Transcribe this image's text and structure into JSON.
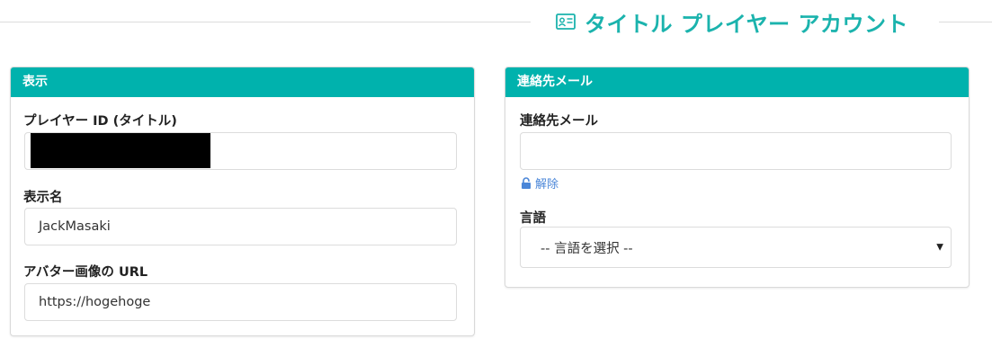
{
  "header": {
    "title": "タイトル プレイヤー アカウント",
    "icon": "id-card-icon",
    "accent_color": "#1bb3ad"
  },
  "display_panel": {
    "heading": "表示",
    "player_id_label": "プレイヤー ID (タイトル)",
    "player_id_value": "",
    "display_name_label": "表示名",
    "display_name_value": "JackMasaki",
    "avatar_url_label": "アバター画像の URL",
    "avatar_url_value": "https://hogehoge"
  },
  "contact_panel": {
    "heading": "連絡先メール",
    "email_label": "連絡先メール",
    "email_value": "",
    "unlock_label": "解除",
    "language_label": "言語",
    "language_selected": "-- 言語を選択 --"
  },
  "colors": {
    "panel_header": "#00b2ad",
    "link": "#4a86d8"
  }
}
